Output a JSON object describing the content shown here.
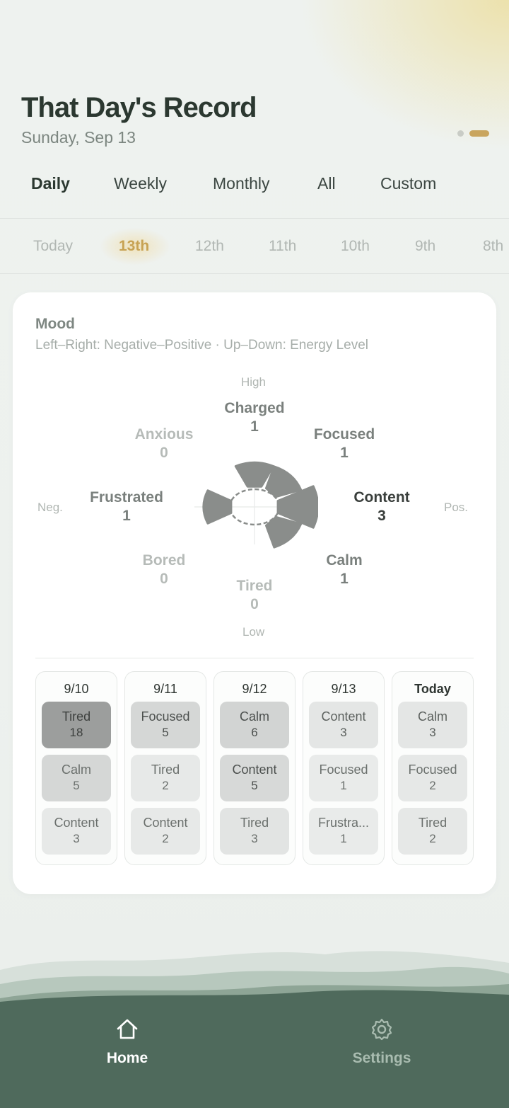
{
  "header": {
    "title": "That Day's Record",
    "date": "Sunday, Sep 13"
  },
  "period_tabs": [
    {
      "label": "Daily",
      "active": true
    },
    {
      "label": "Weekly",
      "active": false
    },
    {
      "label": "Monthly",
      "active": false
    },
    {
      "label": "All",
      "active": false
    },
    {
      "label": "Custom",
      "active": false
    }
  ],
  "days": [
    {
      "label": "Today",
      "active": false
    },
    {
      "label": "13th",
      "active": true
    },
    {
      "label": "12th",
      "active": false
    },
    {
      "label": "11th",
      "active": false
    },
    {
      "label": "10th",
      "active": false
    },
    {
      "label": "9th",
      "active": false
    },
    {
      "label": "8th",
      "active": false
    }
  ],
  "mood_card": {
    "title": "Mood",
    "subtitle": "Left–Right: Negative–Positive · Up–Down: Energy Level",
    "axis": {
      "high": "High",
      "low": "Low",
      "neg": "Neg.",
      "pos": "Pos."
    },
    "moods": {
      "charged": {
        "name": "Charged",
        "count": "1"
      },
      "focused": {
        "name": "Focused",
        "count": "1"
      },
      "content": {
        "name": "Content",
        "count": "3"
      },
      "calm": {
        "name": "Calm",
        "count": "1"
      },
      "tired": {
        "name": "Tired",
        "count": "0"
      },
      "bored": {
        "name": "Bored",
        "count": "0"
      },
      "frustrated": {
        "name": "Frustrated",
        "count": "1"
      },
      "anxious": {
        "name": "Anxious",
        "count": "0"
      }
    }
  },
  "history": [
    {
      "date": "9/10",
      "entries": [
        {
          "name": "Tired",
          "count": "18"
        },
        {
          "name": "Calm",
          "count": "5"
        },
        {
          "name": "Content",
          "count": "3"
        }
      ]
    },
    {
      "date": "9/11",
      "entries": [
        {
          "name": "Focused",
          "count": "5"
        },
        {
          "name": "Tired",
          "count": "2"
        },
        {
          "name": "Content",
          "count": "2"
        }
      ]
    },
    {
      "date": "9/12",
      "entries": [
        {
          "name": "Calm",
          "count": "6"
        },
        {
          "name": "Content",
          "count": "5"
        },
        {
          "name": "Tired",
          "count": "3"
        }
      ]
    },
    {
      "date": "9/13",
      "entries": [
        {
          "name": "Content",
          "count": "3"
        },
        {
          "name": "Focused",
          "count": "1"
        },
        {
          "name": "Frustra...",
          "count": "1"
        }
      ]
    },
    {
      "date": "Today",
      "entries": [
        {
          "name": "Calm",
          "count": "3"
        },
        {
          "name": "Focused",
          "count": "2"
        },
        {
          "name": "Tired",
          "count": "2"
        }
      ]
    }
  ],
  "nav": {
    "home": "Home",
    "settings": "Settings"
  },
  "colors": {
    "accent": "#c7a253",
    "nav_bg": "#4f6a5c",
    "petal": "#8a8d8b"
  }
}
